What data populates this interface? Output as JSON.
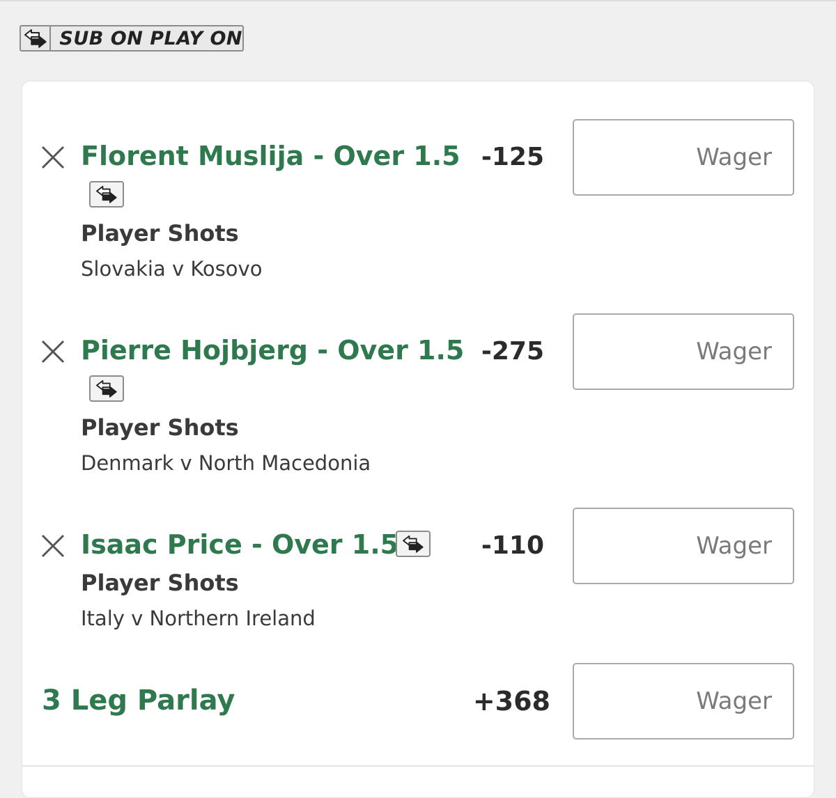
{
  "header": {
    "badge_label": "SUB ON PLAY ON",
    "badge_icon": "substitution-arrows-icon"
  },
  "betslip": {
    "legs": [
      {
        "selection": "Florent Muslija - Over 1.5",
        "market": "Player Shots",
        "event": "Slovakia v Kosovo",
        "odds": "-125",
        "wager_placeholder": "Wager",
        "wager_value": ""
      },
      {
        "selection": "Pierre Hojbjerg - Over 1.5",
        "market": "Player Shots",
        "event": "Denmark v North Macedonia",
        "odds": "-275",
        "wager_placeholder": "Wager",
        "wager_value": ""
      },
      {
        "selection": "Isaac Price - Over 1.5",
        "market": "Player Shots",
        "event": "Italy v Northern Ireland",
        "odds": "-110",
        "wager_placeholder": "Wager",
        "wager_value": ""
      }
    ],
    "parlay": {
      "label": "3 Leg Parlay",
      "odds": "+368",
      "wager_placeholder": "Wager",
      "wager_value": ""
    }
  },
  "colors": {
    "selection_green": "#2e7a4e",
    "page_background": "#f0f0f0",
    "card_background": "#ffffff",
    "text_dark": "#3a3a3a"
  }
}
